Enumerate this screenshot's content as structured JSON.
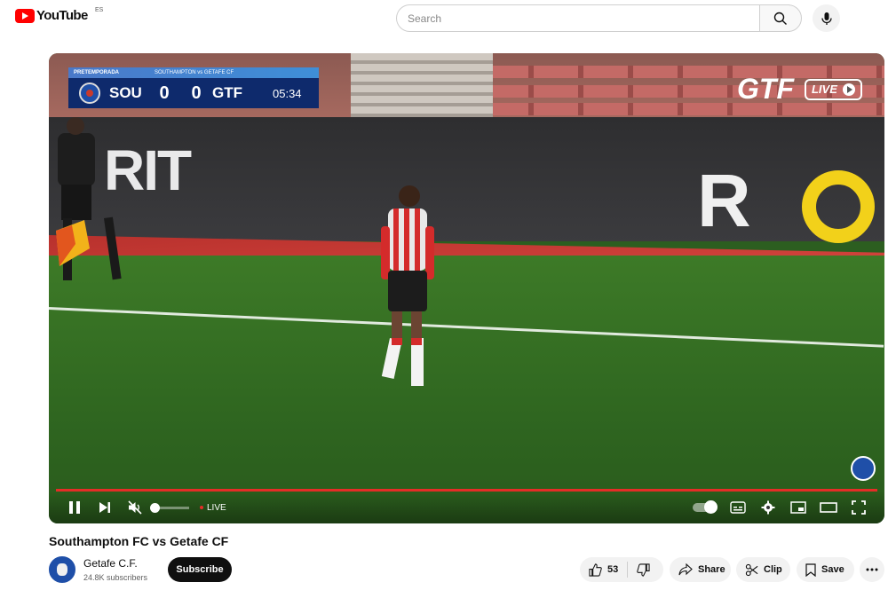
{
  "header": {
    "logo_text": "YouTube",
    "country_code": "ES",
    "search_placeholder": "Search"
  },
  "video": {
    "scorebug": {
      "competition": "PRETEMPORADA",
      "match": "SOUTHAMPTON vs GETAFE CF",
      "home_team": "SOU",
      "home_score": "0",
      "away_score": "0",
      "away_team": "GTF",
      "clock": "05:34"
    },
    "broadcast_logo": "GTF",
    "broadcast_live": "LIVE",
    "board_text_left": "RIT",
    "board_text_right": "R"
  },
  "controls": {
    "live_label": "LIVE",
    "volume_level": 0.0,
    "muted": true,
    "icons": [
      "pause-icon",
      "next-icon",
      "mute-icon",
      "autoplay-toggle",
      "subtitles-icon",
      "settings-gear-icon",
      "miniplayer-icon",
      "theater-icon",
      "fullscreen-icon"
    ]
  },
  "meta": {
    "title": "Southampton FC vs Getafe CF",
    "channel_name": "Getafe C.F.",
    "subscribers": "24.8K subscribers",
    "subscribe_label": "Subscribe",
    "like_count": "53",
    "share_label": "Share",
    "clip_label": "Clip",
    "save_label": "Save"
  },
  "colors": {
    "brand_red": "#ff0000",
    "progress_red": "#e52d27",
    "scorebug_navy": "#0e2a6c"
  }
}
